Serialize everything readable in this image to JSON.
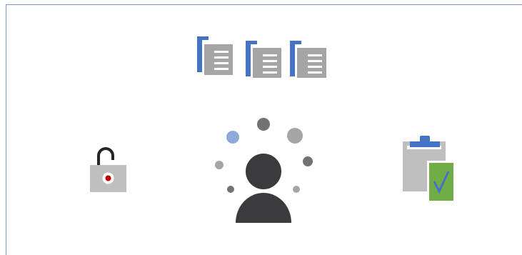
{
  "colors": {
    "frame_border": "#7a96cc",
    "doc_blue": "#4472c4",
    "doc_gray": "#a5a5a5",
    "doc_lines": "#ffffff",
    "lock_body": "#bfbfbf",
    "lock_shackle": "#262626",
    "lock_keyhole_red": "#c00000",
    "person_dark": "#3a3a3f",
    "dot_blue": "#8fa9dc",
    "dot_gray": "#a5a5a5",
    "dot_darkgray": "#767171",
    "clipboard_gray": "#bfbfbf",
    "clipboard_blue": "#4472c4",
    "check_green": "#70ad47",
    "check_mark": "#4472c4"
  },
  "icons": {
    "documents": [
      "document-stack-icon",
      "document-stack-icon",
      "document-stack-icon"
    ],
    "lock": "unlocked-padlock-icon",
    "person": "person-with-ideas-icon",
    "clipboard": "clipboard-checklist-icon"
  }
}
